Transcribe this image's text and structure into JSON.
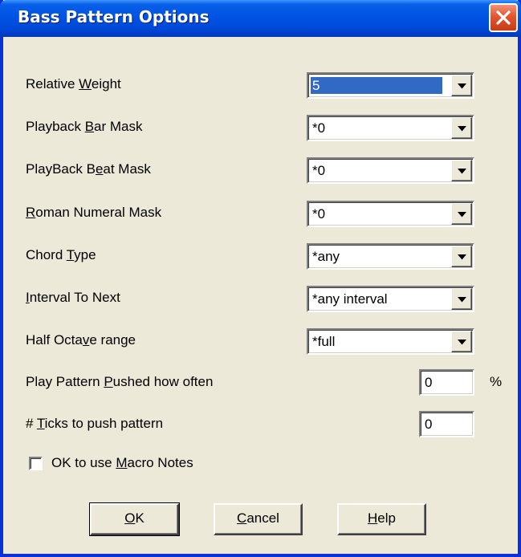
{
  "window": {
    "title": "Bass Pattern Options"
  },
  "fields": {
    "relative_weight": {
      "label_pre": "Relative ",
      "label_u": "W",
      "label_post": "eight",
      "value": "5"
    },
    "playback_bar_mask": {
      "label_pre": "Playback ",
      "label_u": "B",
      "label_post": "ar Mask",
      "value": "*0"
    },
    "playback_beat_mask": {
      "label_pre": "PlayBack B",
      "label_u": "e",
      "label_post": "at Mask",
      "value": "*0"
    },
    "roman_numeral_mask": {
      "label_pre": "",
      "label_u": "R",
      "label_post": "oman Numeral Mask",
      "value": "*0"
    },
    "chord_type": {
      "label_pre": "Chord ",
      "label_u": "T",
      "label_post": "ype",
      "value": "*any"
    },
    "interval_to_next": {
      "label_pre": "",
      "label_u": "I",
      "label_post": "nterval To Next",
      "value": "*any interval"
    },
    "half_octave_range": {
      "label_pre": "Half Octa",
      "label_u": "v",
      "label_post": "e range",
      "value": "*full"
    },
    "pushed_how_often": {
      "label_pre": "Play Pattern ",
      "label_u": "P",
      "label_post": "ushed how often",
      "value": "0",
      "unit": "%"
    },
    "ticks_to_push": {
      "label_pre": "# ",
      "label_u": "T",
      "label_post": "icks to push pattern",
      "value": "0"
    }
  },
  "checkbox": {
    "label_pre": "OK to use ",
    "label_u": "M",
    "label_post": "acro Notes",
    "checked": false
  },
  "buttons": {
    "ok": {
      "u": "O",
      "rest": "K"
    },
    "cancel": {
      "u": "C",
      "rest": "ancel"
    },
    "help": {
      "u": "H",
      "rest": "elp"
    }
  },
  "colors": {
    "titlebar": "#0055e5",
    "dialog_bg": "#ece9d8",
    "close_button": "#e2552f",
    "selection": "#316ac5"
  }
}
